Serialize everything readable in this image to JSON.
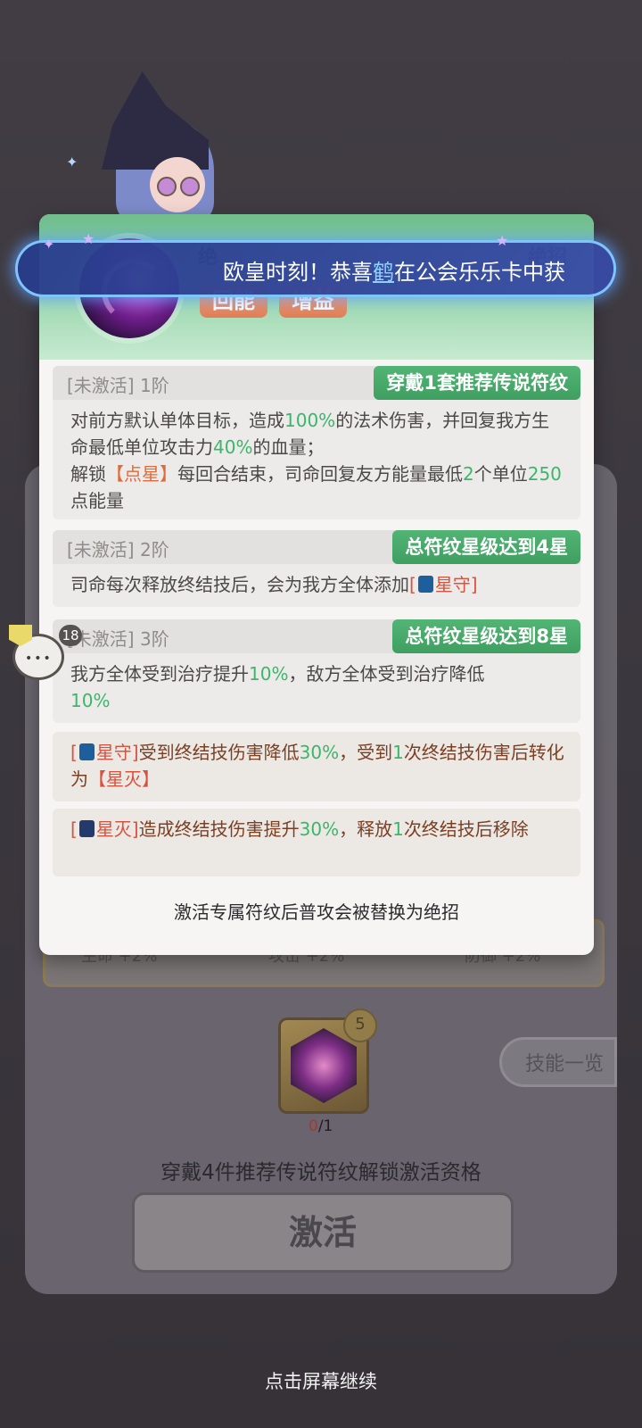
{
  "banner": {
    "prefix": "欧皇时刻！恭喜",
    "player": "鹤",
    "suffix": "在公会乐乐卡中获"
  },
  "header": {
    "tags": [
      "回能",
      "增益"
    ],
    "left_label": "绝",
    "right_label": "绝招"
  },
  "tiers": [
    {
      "state": "[未激活]",
      "level": "1阶",
      "badge": "穿戴1套推荐传说符纹"
    },
    {
      "state": "[未激活]",
      "level": "2阶",
      "badge": "总符纹星级达到4星"
    },
    {
      "state": "[未激活]",
      "level": "3阶",
      "badge": "总符纹星级达到8星"
    }
  ],
  "tier1_text": {
    "a": "对前方默认单体目标，造成",
    "b": "100%",
    "c": "的法术伤害，并回复我方生命最低单位攻击力",
    "d": "40%",
    "e": "的血量；",
    "f": "解锁",
    "g": "【点星】",
    "h": "每回合结束，司命回复友方能量最低",
    "i": "2",
    "j": "个单位",
    "k": "250",
    "l": "点能量"
  },
  "tier2_text": {
    "a": "司命每次释放终结技后，会为我方全体添加",
    "b1": "[",
    "b2": "星守]"
  },
  "tier3_text": {
    "a": "我方全体受到治疗提升",
    "b": "10%",
    "c": "，敌方全体受到治疗降低",
    "d": "10%"
  },
  "note1": {
    "o1": "[",
    "name": "星守]",
    "a": "受到终结技伤害降低",
    "b": "30%",
    "c": "，受到",
    "d": "1",
    "e": "次终结技伤害后转化为",
    "f": "【星灭】"
  },
  "note2": {
    "o1": "[",
    "name": "星灭]",
    "a": "造成终结技伤害提升",
    "b": "30%",
    "c": "，释放",
    "d": "1",
    "e": "次终结技后移除"
  },
  "footer": "激活专属符纹后普攻会被替换为绝招",
  "background": {
    "stats": [
      "生命 +2%",
      "攻击 +2%",
      "防御 +2%"
    ],
    "gem_count_current": "0",
    "gem_count_total": "/1",
    "gem_badge": "5",
    "skill_list": "技能一览",
    "unlock_tip": "穿戴4件推荐传说符纹解锁激活资格",
    "activate": "激活",
    "continue": "点击屏幕继续"
  },
  "chat": {
    "count": "18"
  },
  "colors": {
    "badge_green": "#3f9f61",
    "highlight_green": "#3cb66a",
    "highlight_orange": "#e06b39",
    "banner_glow": "#7ec4ff"
  }
}
